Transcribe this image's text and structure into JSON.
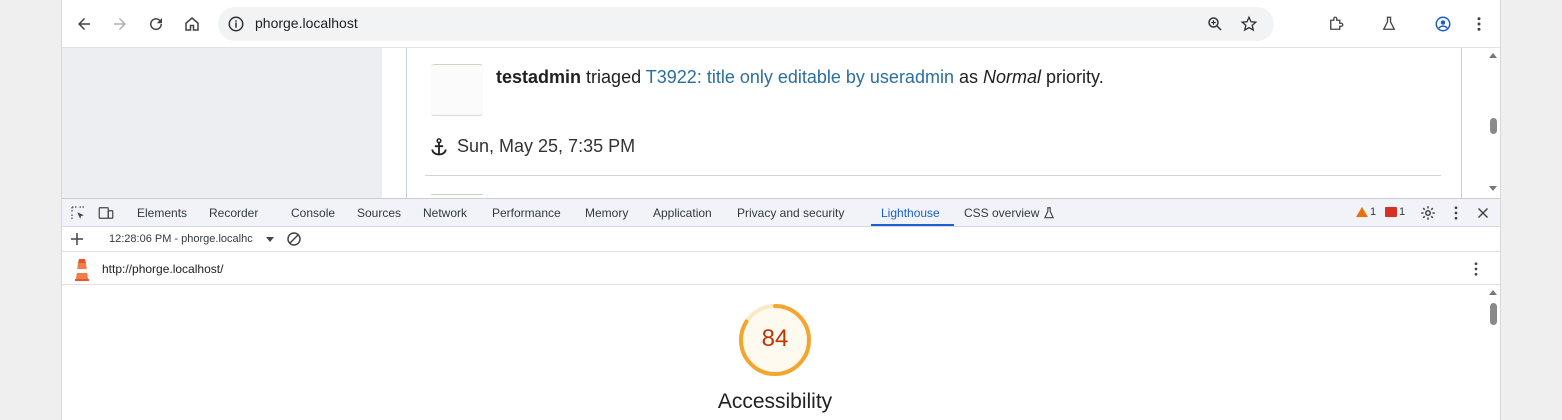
{
  "browser": {
    "url": "phorge.localhost",
    "nav": {
      "back": "back-icon",
      "forward": "forward-icon",
      "reload": "reload-icon",
      "home": "home-icon"
    },
    "right_icons": [
      "zoom-icon",
      "star-icon",
      "extensions-icon",
      "labs-icon",
      "profile-icon",
      "menu-icon"
    ]
  },
  "page": {
    "actor": "testadmin",
    "verb": "triaged",
    "task_link": "T3922: title only editable by useradmin",
    "as_word": "as",
    "priority": "Normal",
    "priority_suffix": "priority.",
    "timestamp": "Sun, May 25, 7:35 PM"
  },
  "devtools": {
    "tabs": [
      "Elements",
      "Recorder",
      "Console",
      "Sources",
      "Network",
      "Performance",
      "Memory",
      "Application",
      "Privacy and security",
      "Lighthouse",
      "CSS overview"
    ],
    "active_tab": "Lighthouse",
    "warnings_count": "1",
    "errors_count": "1",
    "colors": {
      "accent": "#1a5fd0",
      "warning": "#e8710a",
      "error": "#d93025"
    }
  },
  "lighthouse": {
    "report_select": "12:28:06 PM - phorge.localhc",
    "report_url": "http://phorge.localhost/",
    "score": "84",
    "score_fraction": 0.84,
    "category": "Accessibility",
    "score_color": "#f4a530"
  }
}
